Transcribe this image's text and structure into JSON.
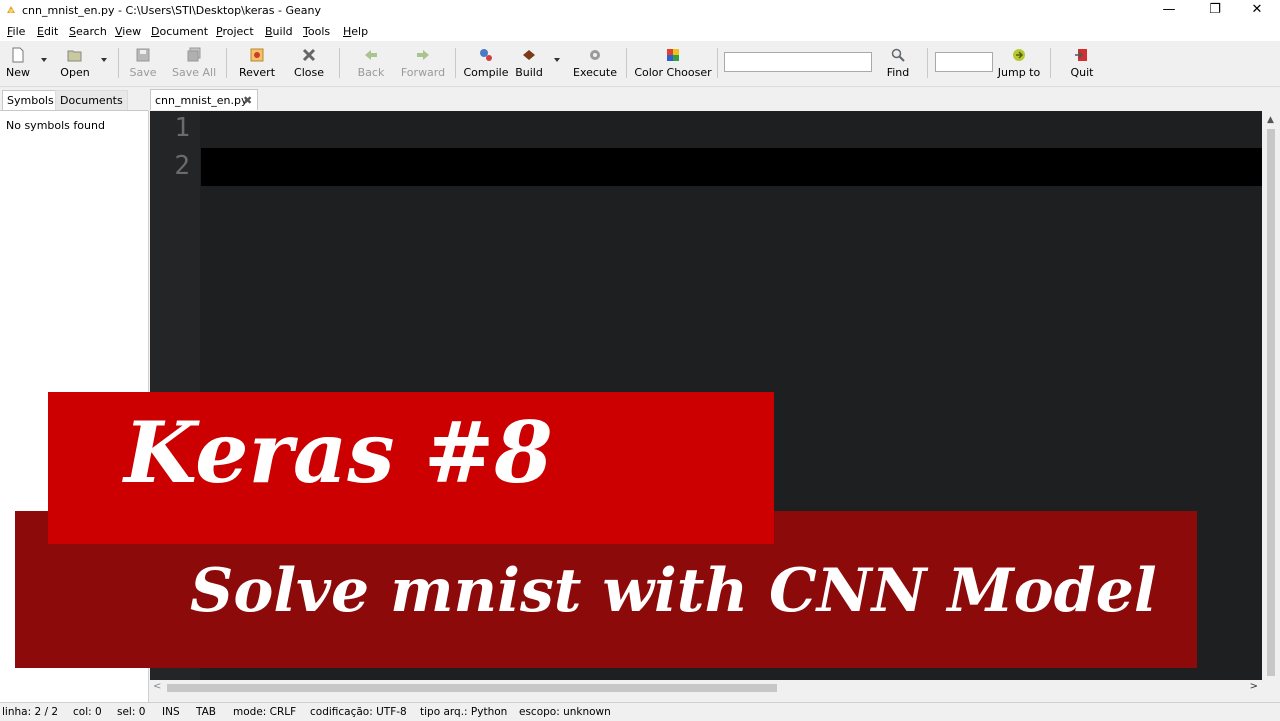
{
  "window": {
    "title": "cnn_mnist_en.py - C:\\Users\\STI\\Desktop\\keras - Geany",
    "minimize": "—",
    "maximize": "❐",
    "close": "✕"
  },
  "menu": [
    "File",
    "Edit",
    "Search",
    "View",
    "Document",
    "Project",
    "Build",
    "Tools",
    "Help"
  ],
  "toolbar": {
    "new": "New",
    "open": "Open",
    "save": "Save",
    "save_all": "Save All",
    "revert": "Revert",
    "close": "Close",
    "back": "Back",
    "forward": "Forward",
    "compile": "Compile",
    "build": "Build",
    "execute": "Execute",
    "color_chooser": "Color Chooser",
    "find": "Find",
    "jump_to": "Jump to",
    "quit": "Quit",
    "search_value": "",
    "jump_value": ""
  },
  "sidebar": {
    "tabs": [
      "Symbols",
      "Documents"
    ],
    "empty_text": "No symbols found"
  },
  "editor": {
    "tab_name": "cnn_mnist_en.py",
    "line_numbers": [
      "1",
      "2"
    ]
  },
  "status": {
    "line": "linha: 2 / 2",
    "col": "col: 0",
    "sel": "sel: 0",
    "ins": "INS",
    "tab": "TAB",
    "mode": "mode: CRLF",
    "encoding": "codificação: UTF-8",
    "filetype": "tipo arq.: Python",
    "scope": "escopo: unknown"
  },
  "banner": {
    "title": "Keras #8",
    "subtitle": "Solve mnist with CNN Model"
  },
  "colors": {
    "banner_bright_red": "#cc0000",
    "banner_dark_red": "#8d0a0a",
    "editor_bg": "#1e1f20"
  }
}
